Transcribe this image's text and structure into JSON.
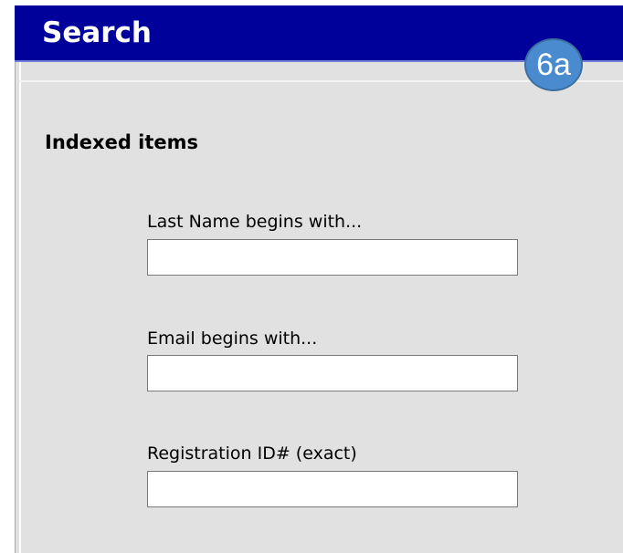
{
  "header": {
    "title": "Search"
  },
  "badge": {
    "label": "6a"
  },
  "section": {
    "title": "Indexed items"
  },
  "fields": [
    {
      "label": "Last Name begins with...",
      "value": "",
      "placeholder": ""
    },
    {
      "label": "Email begins with...",
      "value": "",
      "placeholder": ""
    },
    {
      "label": "Registration ID# (exact)",
      "value": "",
      "placeholder": ""
    }
  ],
  "colors": {
    "header_bg": "#00009a",
    "panel_bg": "#e1e1e1",
    "badge_bg": "#4a8bd0"
  }
}
